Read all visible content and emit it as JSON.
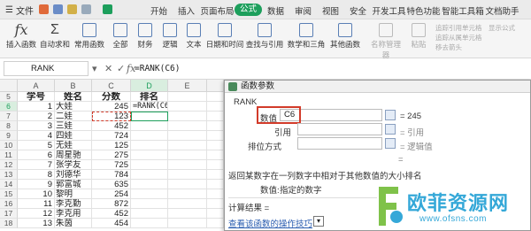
{
  "menu": {
    "file": "文件"
  },
  "ribbon_tabs": [
    "开始",
    "插入",
    "页面布局",
    "公式",
    "数据",
    "审阅",
    "视图",
    "安全",
    "开发工具",
    "特色功能",
    "智能工具箱",
    "文档助手"
  ],
  "toolbar": {
    "insert_function": "插入函数",
    "autosum": "自动求和",
    "common_functions": "常用函数",
    "all": "全部",
    "finance": "财务",
    "logic": "逻辑",
    "text": "文本",
    "datetime": "日期和时间",
    "lookup": "查找与引用",
    "math": "数学和三角",
    "other": "其他函数",
    "name_manager": "名称管理器",
    "paste": "粘贴",
    "trace_precedents": "追踪引用单元格",
    "trace_dependents": "追踪从属单元格",
    "remove_arrows": "移去箭头",
    "show_formulas": "显示公式"
  },
  "formula_bar": {
    "name_box": "RANK",
    "formula": "=RANK(C6)"
  },
  "sheet": {
    "col_headers": [
      "A",
      "B",
      "C",
      "D",
      "E"
    ],
    "rows": [
      {
        "r": "5",
        "a": "学号",
        "b": "姓名",
        "c": "分数",
        "d": "排名"
      },
      {
        "r": "6",
        "a": "1",
        "b": "大娃",
        "c": "245",
        "d": "=RANK(C6)"
      },
      {
        "r": "7",
        "a": "2",
        "b": "二娃",
        "c": "123",
        "d": ""
      },
      {
        "r": "8",
        "a": "3",
        "b": "三娃",
        "c": "452",
        "d": ""
      },
      {
        "r": "9",
        "a": "4",
        "b": "四娃",
        "c": "724",
        "d": ""
      },
      {
        "r": "10",
        "a": "5",
        "b": "无娃",
        "c": "125",
        "d": ""
      },
      {
        "r": "11",
        "a": "6",
        "b": "周星驰",
        "c": "275",
        "d": ""
      },
      {
        "r": "12",
        "a": "7",
        "b": "张学友",
        "c": "725",
        "d": ""
      },
      {
        "r": "13",
        "a": "8",
        "b": "刘德华",
        "c": "784",
        "d": ""
      },
      {
        "r": "14",
        "a": "9",
        "b": "郭富城",
        "c": "635",
        "d": ""
      },
      {
        "r": "15",
        "a": "10",
        "b": "黎明",
        "c": "254",
        "d": ""
      },
      {
        "r": "16",
        "a": "11",
        "b": "李克勤",
        "c": "872",
        "d": ""
      },
      {
        "r": "17",
        "a": "12",
        "b": "李克用",
        "c": "452",
        "d": ""
      },
      {
        "r": "18",
        "a": "13",
        "b": "朱茵",
        "c": "454",
        "d": ""
      }
    ]
  },
  "dialog": {
    "title": "函数参数",
    "function_name": "RANK",
    "arg1_label": "数值",
    "arg1_value": "C6",
    "arg1_result": "= 245",
    "arg2_label": "引用",
    "arg2_result": "= 引用",
    "arg3_label": "排位方式",
    "arg3_result": "= 逻辑值",
    "equals_sign": "=",
    "description": "返回某数字在一列数字中相对于其他数值的大小排名",
    "param_desc_label": "数值:",
    "param_desc_text": "指定的数字",
    "calc_result_label": "计算结果 =",
    "help_link": "查看该函数的操作技巧"
  },
  "watermark": {
    "text": "欧菲资源网",
    "sub": "www.ofsns.com"
  },
  "colors": {
    "accent_green": "#1d9f5c",
    "highlight_red": "#d23b2a",
    "watermark_blue": "#35a8d8"
  }
}
